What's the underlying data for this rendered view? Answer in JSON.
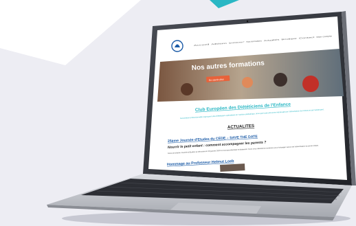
{
  "nav": {
    "items": [
      "Accueil",
      "Adhésion",
      "Qui sommes-nous ?",
      "Nos formations",
      "Actualités",
      "Boutique",
      "Contact",
      "Mon compte"
    ]
  },
  "hero": {
    "title": "Nos autres formations",
    "button_label": "En savoir plus"
  },
  "club": {
    "title": "Club Européen des Diététiciens de l'Enfance",
    "intro": "Association professionnelle regroupant des Diététiciens spécialisés en nutrition pédiatrique, ainsi que toute personne intéressée par l'alimentation de l'enfant et de l'adolescent."
  },
  "news": {
    "heading": "ACTUALITES",
    "event_title": "25ème Journée d'Etudes du CEDE – SAVE THE DATE",
    "event_subtitle": "Nourrir le petit enfant : comment accompagner les parents ?",
    "event_body": "Notre prochaine Journée d'Etudes se déroulera le 20 janvier 2022 en format présentiel et distanciel. Nous vous attendons nombreux pour échanger autour de l'alimentation du jeune enfant.",
    "tribute_title": "Hommage au Professeur Helmut Loeb"
  },
  "colors": {
    "background": "#ededf3",
    "accent_teal": "#2ab7c4",
    "site_blue": "#1a5aa6",
    "hero_orange": "#e8623a"
  }
}
